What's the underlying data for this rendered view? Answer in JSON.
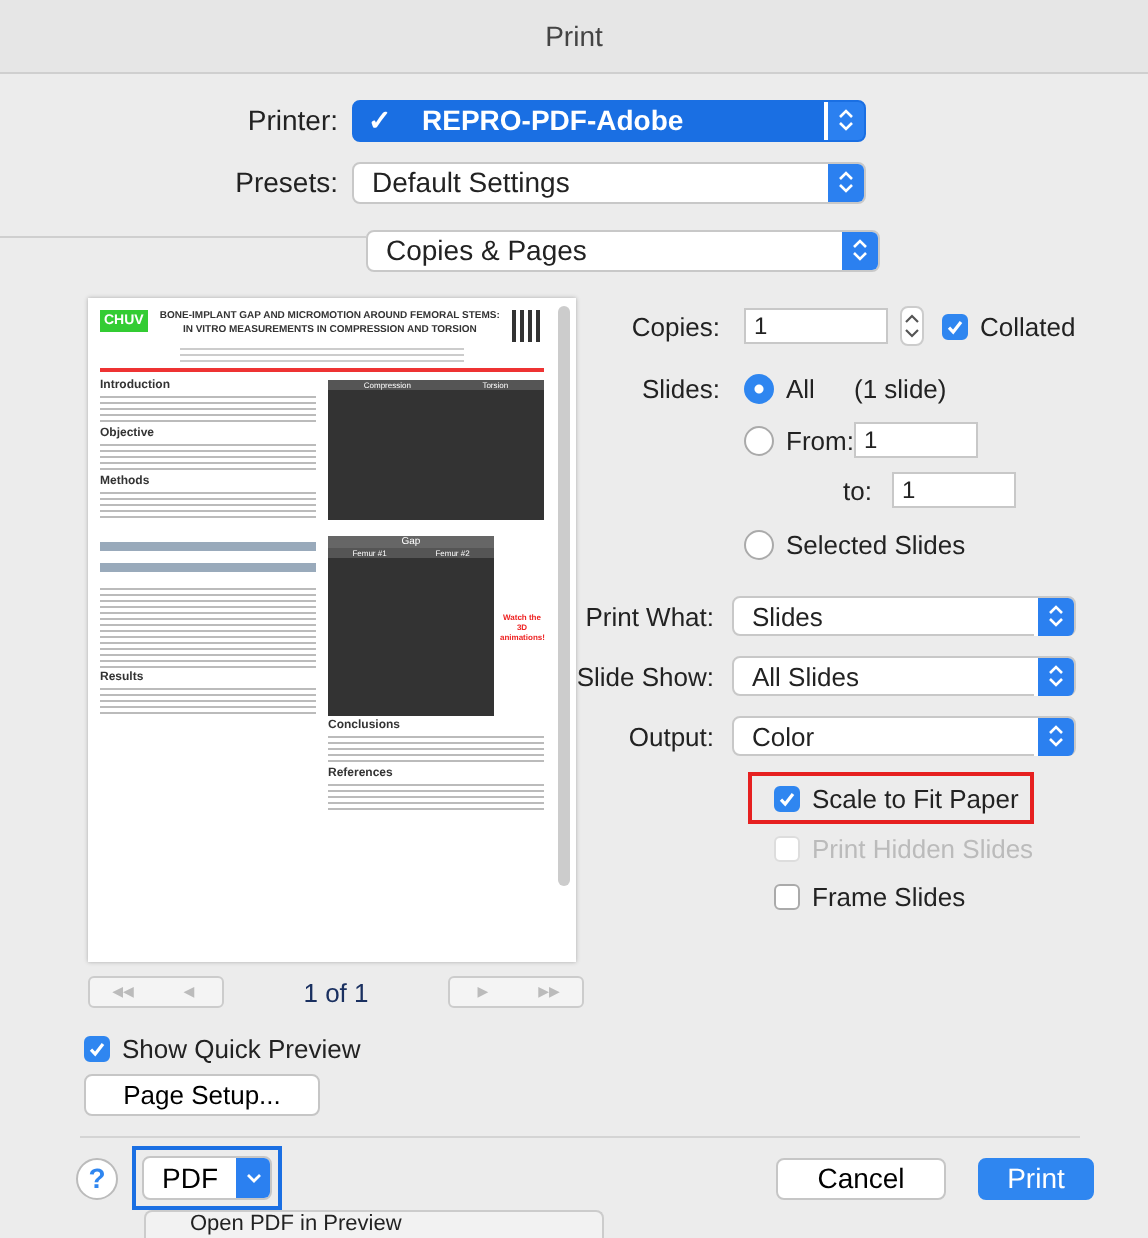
{
  "window": {
    "title": "Print"
  },
  "printer": {
    "label": "Printer:",
    "mark": "✓",
    "value": "REPRO-PDF-Adobe"
  },
  "presets": {
    "label": "Presets:",
    "value": "Default Settings"
  },
  "section": {
    "value": "Copies & Pages"
  },
  "preview": {
    "logo": "CHUV",
    "title": "BONE-IMPLANT GAP AND MICROMOTION AROUND FEMORAL STEMS: IN VITRO MEASUREMENTS IN COMPRESSION AND TORSION",
    "left_headings": [
      "Introduction",
      "Objective",
      "Methods"
    ],
    "results_heading": "Results",
    "figure_top": {
      "labels": [
        "Compression",
        "Torsion"
      ]
    },
    "figure_gap": {
      "title": "Gap",
      "labels": [
        "Femur #1",
        "Femur #2"
      ]
    },
    "callout": "Watch the 3D animations!",
    "right_headings": [
      "Conclusions",
      "References"
    ]
  },
  "pager": {
    "first": "◀◀",
    "prev": "◀",
    "text": "1 of 1",
    "next": "▶",
    "last": "▶▶"
  },
  "copies": {
    "label": "Copies:",
    "value": "1"
  },
  "collated": {
    "label": "Collated",
    "checked": true
  },
  "slides": {
    "label": "Slides:",
    "note": "(1 slide)",
    "from": "1",
    "to_label": "to:",
    "to": "1",
    "options": [
      {
        "label": "All",
        "selected": true
      },
      {
        "label": "From:",
        "selected": false
      },
      {
        "label": "Selected Slides",
        "selected": false
      }
    ]
  },
  "selects": [
    {
      "label": "Print What:",
      "value": "Slides"
    },
    {
      "label": "Slide Show:",
      "value": "All Slides"
    },
    {
      "label": "Output:",
      "value": "Color"
    }
  ],
  "options": [
    {
      "label": "Scale to Fit Paper",
      "checked": true,
      "disabled": false,
      "highlighted": true
    },
    {
      "label": "Print Hidden Slides",
      "checked": false,
      "disabled": true,
      "highlighted": false
    },
    {
      "label": "Frame Slides",
      "checked": false,
      "disabled": false,
      "highlighted": false
    }
  ],
  "quick_preview": {
    "label": "Show Quick Preview",
    "checked": true
  },
  "page_setup": "Page Setup...",
  "help": "?",
  "pdf": {
    "label": "PDF",
    "highlighted": true
  },
  "cancel": "Cancel",
  "print": "Print",
  "menu": {
    "items": [
      "Open PDF in Preview"
    ]
  }
}
